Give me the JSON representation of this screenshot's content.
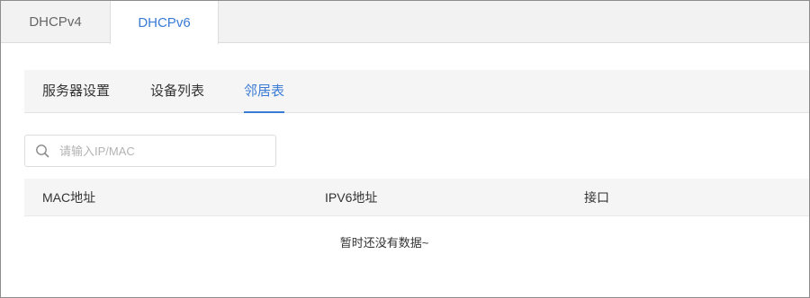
{
  "top_tabs": [
    {
      "label": "DHCPv4",
      "active": false
    },
    {
      "label": "DHCPv6",
      "active": true
    }
  ],
  "sub_tabs": [
    {
      "label": "服务器设置",
      "active": false
    },
    {
      "label": "设备列表",
      "active": false
    },
    {
      "label": "邻居表",
      "active": true
    }
  ],
  "search": {
    "placeholder": "请输入IP/MAC",
    "value": "",
    "icon": "search-icon"
  },
  "table": {
    "columns": [
      "MAC地址",
      "IPV6地址",
      "接口"
    ],
    "rows": [],
    "empty_text": "暂时还没有数据~"
  },
  "colors": {
    "accent": "#3a7bd5",
    "tab_bar_bg": "#f2f2f2",
    "header_bg": "#f5f5f5"
  }
}
